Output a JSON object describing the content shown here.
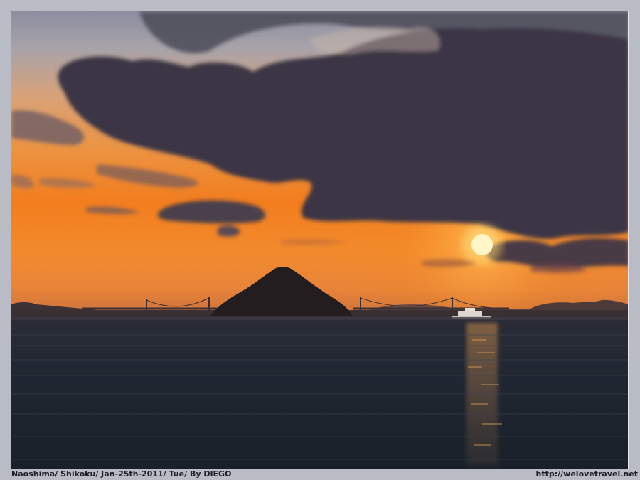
{
  "photo": {
    "subject": "sunset-over-sea",
    "colors": {
      "sky_top": "#8e8fa0",
      "sky_mid": "#e79a4f",
      "sky_low": "#f07a1c",
      "horizon": "#f38a2a",
      "sun": "#fff3b0",
      "cloud": "#3c3746",
      "island": "#241d20",
      "sea": "#1f2530"
    }
  },
  "caption": {
    "left": "Naoshima/ Shikoku/ Jan-25th-2011/ Tue/ By DIEGO",
    "right": "http://welovetravel.net"
  }
}
